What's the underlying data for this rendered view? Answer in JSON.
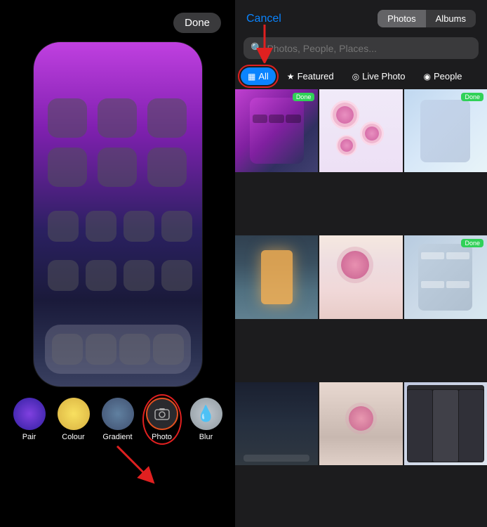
{
  "left": {
    "done_label": "Done",
    "toolbar": {
      "items": [
        {
          "id": "pair",
          "label": "Pair",
          "icon_class": "icon-pair",
          "icon_char": "⬤"
        },
        {
          "id": "colour",
          "label": "Colour",
          "icon_class": "icon-colour",
          "icon_char": "⬤"
        },
        {
          "id": "gradient",
          "label": "Gradient",
          "icon_class": "icon-gradient",
          "icon_char": "⬤"
        },
        {
          "id": "photo",
          "label": "Photo",
          "icon_class": "icon-photo",
          "icon_char": "🖼"
        },
        {
          "id": "blur",
          "label": "Blur",
          "icon_class": "icon-blur",
          "icon_char": "💧"
        }
      ]
    }
  },
  "right": {
    "cancel_label": "Cancel",
    "tabs": [
      {
        "id": "photos",
        "label": "Photos",
        "active": true
      },
      {
        "id": "albums",
        "label": "Albums",
        "active": false
      }
    ],
    "search_placeholder": "Photos, People, Places...",
    "filters": [
      {
        "id": "all",
        "label": "All",
        "icon": "▦",
        "active": true
      },
      {
        "id": "featured",
        "label": "Featured",
        "icon": "★",
        "active": false
      },
      {
        "id": "livephoto",
        "label": "Live Photo",
        "icon": "◎",
        "active": false
      },
      {
        "id": "people",
        "label": "People",
        "icon": "◉",
        "active": false
      }
    ]
  }
}
